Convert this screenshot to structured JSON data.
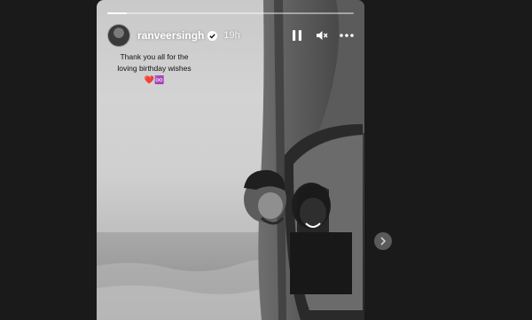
{
  "story": {
    "username": "ranveersingh",
    "time_ago": "19h",
    "progress_fraction": 0.08,
    "caption_line1": "Thank you all for the",
    "caption_line2": "loving birthday wishes",
    "caption_emoji": "❤️♾️"
  },
  "icons": {
    "pause": "pause-icon",
    "mute": "mute-icon",
    "more": "more-icon",
    "next": "chevron-right-icon",
    "verified": "verified-badge-icon"
  },
  "colors": {
    "page_bg": "#1a1a1a",
    "heart": "#d9142b",
    "next_button_bg": "#5a5a5a"
  }
}
